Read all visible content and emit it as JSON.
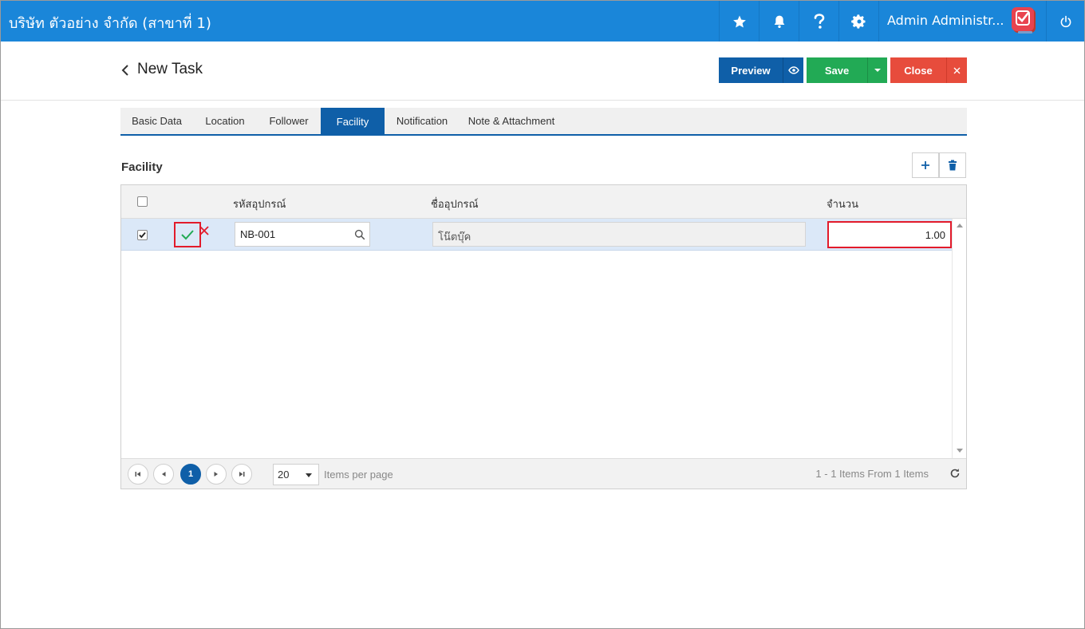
{
  "topbar": {
    "company": "บริษัท ตัวอย่าง จำกัด (สาขาที่ 1)",
    "user_name": "Admin Administr...",
    "icons": [
      "star-icon",
      "bell-icon",
      "help-icon",
      "gear-icon",
      "power-icon"
    ],
    "bar_color": "#1a86d9"
  },
  "header": {
    "title": "New Task",
    "preview_label": "Preview",
    "save_label": "Save",
    "close_label": "Close"
  },
  "tabs": [
    {
      "label": "Basic Data",
      "active": false
    },
    {
      "label": "Location",
      "active": false
    },
    {
      "label": "Follower",
      "active": false
    },
    {
      "label": "Facility",
      "active": true
    },
    {
      "label": "Notification",
      "active": false
    },
    {
      "label": "Note & Attachment",
      "active": false
    }
  ],
  "facility": {
    "title": "Facility",
    "columns": {
      "code": "รหัสอุปกรณ์",
      "name": "ชื่ออุปกรณ์",
      "qty": "จำนวน"
    },
    "rows": [
      {
        "checked": true,
        "code": "NB-001",
        "name": "โน๊ตบุ๊ค",
        "qty": "1.00"
      }
    ]
  },
  "pager": {
    "current_page": "1",
    "page_size": "20",
    "items_per_page_label": "Items per page",
    "info": "1 - 1 Items From 1 Items"
  },
  "colors": {
    "primary": "#0f5fa8",
    "success": "#22aa55",
    "danger": "#e74c3c",
    "highlight": "#e21b2b"
  }
}
